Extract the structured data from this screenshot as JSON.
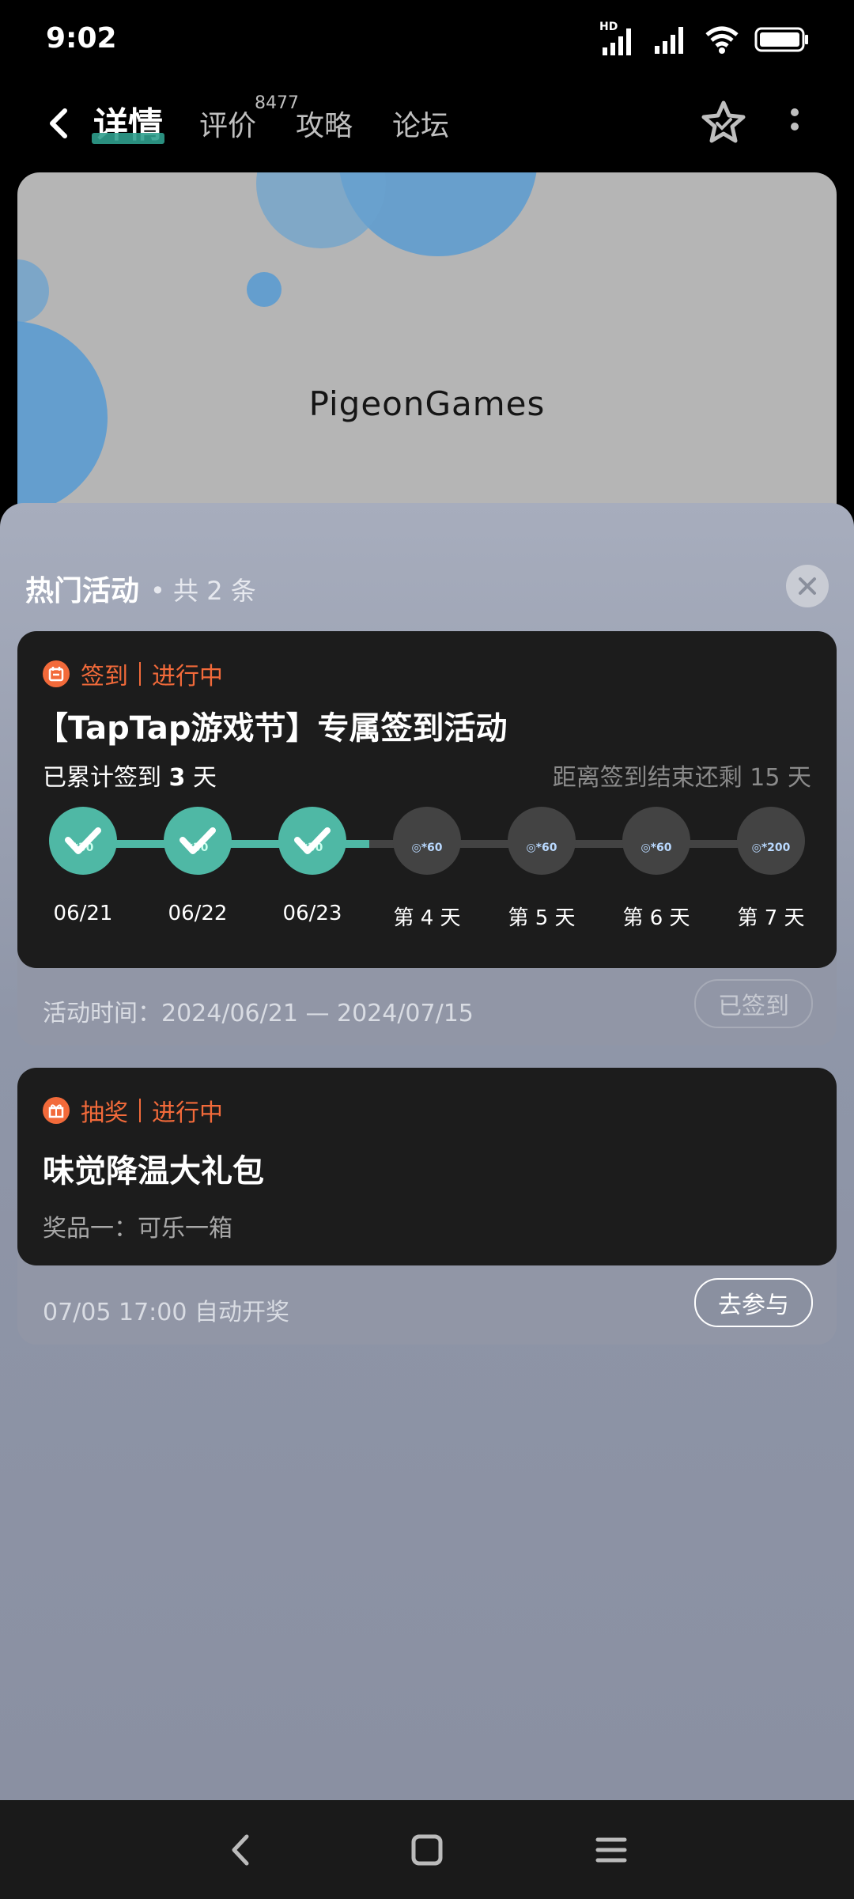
{
  "status_bar": {
    "time": "9:02",
    "hd_label": "HD"
  },
  "nav": {
    "tabs": [
      {
        "label": "详情"
      },
      {
        "label": "评价"
      },
      {
        "label": "攻略"
      },
      {
        "label": "论坛"
      }
    ],
    "review_count": "8477"
  },
  "banner": {
    "logo_text": "PigeonGames"
  },
  "sheet": {
    "title": "热门活动",
    "count_text": "• 共 2 条"
  },
  "signin_card": {
    "tag_type": "签到",
    "tag_status": "进行中",
    "title": "【TapTap游戏节】专属签到活动",
    "accum_prefix": "已累计签到",
    "accum_days": "3",
    "accum_suffix": "天",
    "remaining": "距离签到结束还剩 15 天",
    "days": [
      {
        "label": "06/21",
        "reward": "*30",
        "done": true
      },
      {
        "label": "06/22",
        "reward": "*30",
        "done": true
      },
      {
        "label": "06/23",
        "reward": "*30",
        "done": true
      },
      {
        "label": "第 4 天",
        "reward": "◎*60",
        "done": false
      },
      {
        "label": "第 5 天",
        "reward": "◎*60",
        "done": false
      },
      {
        "label": "第 6 天",
        "reward": "◎*60",
        "done": false
      },
      {
        "label": "第 7 天",
        "reward": "◎*200",
        "done": false
      }
    ],
    "period": "活动时间：2024/06/21 — 2024/07/15",
    "button": "已签到"
  },
  "lottery_card": {
    "tag_type": "抽奖",
    "tag_status": "进行中",
    "title": "味觉降温大礼包",
    "prize": "奖品一：可乐一箱",
    "draw_time": "07/05 17:00 自动开奖",
    "button": "去参与"
  },
  "colors": {
    "accent_orange": "#f26a3a",
    "accent_teal": "#4fb8a5",
    "card_bg": "#1c1c1c"
  }
}
